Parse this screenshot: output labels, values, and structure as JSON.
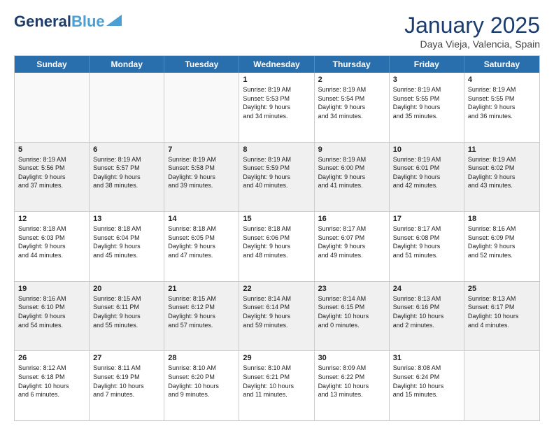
{
  "header": {
    "logo_general": "General",
    "logo_blue": "Blue",
    "month_title": "January 2025",
    "location": "Daya Vieja, Valencia, Spain"
  },
  "days_of_week": [
    "Sunday",
    "Monday",
    "Tuesday",
    "Wednesday",
    "Thursday",
    "Friday",
    "Saturday"
  ],
  "weeks": [
    [
      {
        "day": "",
        "text": ""
      },
      {
        "day": "",
        "text": ""
      },
      {
        "day": "",
        "text": ""
      },
      {
        "day": "1",
        "text": "Sunrise: 8:19 AM\nSunset: 5:53 PM\nDaylight: 9 hours\nand 34 minutes."
      },
      {
        "day": "2",
        "text": "Sunrise: 8:19 AM\nSunset: 5:54 PM\nDaylight: 9 hours\nand 34 minutes."
      },
      {
        "day": "3",
        "text": "Sunrise: 8:19 AM\nSunset: 5:55 PM\nDaylight: 9 hours\nand 35 minutes."
      },
      {
        "day": "4",
        "text": "Sunrise: 8:19 AM\nSunset: 5:55 PM\nDaylight: 9 hours\nand 36 minutes."
      }
    ],
    [
      {
        "day": "5",
        "text": "Sunrise: 8:19 AM\nSunset: 5:56 PM\nDaylight: 9 hours\nand 37 minutes."
      },
      {
        "day": "6",
        "text": "Sunrise: 8:19 AM\nSunset: 5:57 PM\nDaylight: 9 hours\nand 38 minutes."
      },
      {
        "day": "7",
        "text": "Sunrise: 8:19 AM\nSunset: 5:58 PM\nDaylight: 9 hours\nand 39 minutes."
      },
      {
        "day": "8",
        "text": "Sunrise: 8:19 AM\nSunset: 5:59 PM\nDaylight: 9 hours\nand 40 minutes."
      },
      {
        "day": "9",
        "text": "Sunrise: 8:19 AM\nSunset: 6:00 PM\nDaylight: 9 hours\nand 41 minutes."
      },
      {
        "day": "10",
        "text": "Sunrise: 8:19 AM\nSunset: 6:01 PM\nDaylight: 9 hours\nand 42 minutes."
      },
      {
        "day": "11",
        "text": "Sunrise: 8:19 AM\nSunset: 6:02 PM\nDaylight: 9 hours\nand 43 minutes."
      }
    ],
    [
      {
        "day": "12",
        "text": "Sunrise: 8:18 AM\nSunset: 6:03 PM\nDaylight: 9 hours\nand 44 minutes."
      },
      {
        "day": "13",
        "text": "Sunrise: 8:18 AM\nSunset: 6:04 PM\nDaylight: 9 hours\nand 45 minutes."
      },
      {
        "day": "14",
        "text": "Sunrise: 8:18 AM\nSunset: 6:05 PM\nDaylight: 9 hours\nand 47 minutes."
      },
      {
        "day": "15",
        "text": "Sunrise: 8:18 AM\nSunset: 6:06 PM\nDaylight: 9 hours\nand 48 minutes."
      },
      {
        "day": "16",
        "text": "Sunrise: 8:17 AM\nSunset: 6:07 PM\nDaylight: 9 hours\nand 49 minutes."
      },
      {
        "day": "17",
        "text": "Sunrise: 8:17 AM\nSunset: 6:08 PM\nDaylight: 9 hours\nand 51 minutes."
      },
      {
        "day": "18",
        "text": "Sunrise: 8:16 AM\nSunset: 6:09 PM\nDaylight: 9 hours\nand 52 minutes."
      }
    ],
    [
      {
        "day": "19",
        "text": "Sunrise: 8:16 AM\nSunset: 6:10 PM\nDaylight: 9 hours\nand 54 minutes."
      },
      {
        "day": "20",
        "text": "Sunrise: 8:15 AM\nSunset: 6:11 PM\nDaylight: 9 hours\nand 55 minutes."
      },
      {
        "day": "21",
        "text": "Sunrise: 8:15 AM\nSunset: 6:12 PM\nDaylight: 9 hours\nand 57 minutes."
      },
      {
        "day": "22",
        "text": "Sunrise: 8:14 AM\nSunset: 6:14 PM\nDaylight: 9 hours\nand 59 minutes."
      },
      {
        "day": "23",
        "text": "Sunrise: 8:14 AM\nSunset: 6:15 PM\nDaylight: 10 hours\nand 0 minutes."
      },
      {
        "day": "24",
        "text": "Sunrise: 8:13 AM\nSunset: 6:16 PM\nDaylight: 10 hours\nand 2 minutes."
      },
      {
        "day": "25",
        "text": "Sunrise: 8:13 AM\nSunset: 6:17 PM\nDaylight: 10 hours\nand 4 minutes."
      }
    ],
    [
      {
        "day": "26",
        "text": "Sunrise: 8:12 AM\nSunset: 6:18 PM\nDaylight: 10 hours\nand 6 minutes."
      },
      {
        "day": "27",
        "text": "Sunrise: 8:11 AM\nSunset: 6:19 PM\nDaylight: 10 hours\nand 7 minutes."
      },
      {
        "day": "28",
        "text": "Sunrise: 8:10 AM\nSunset: 6:20 PM\nDaylight: 10 hours\nand 9 minutes."
      },
      {
        "day": "29",
        "text": "Sunrise: 8:10 AM\nSunset: 6:21 PM\nDaylight: 10 hours\nand 11 minutes."
      },
      {
        "day": "30",
        "text": "Sunrise: 8:09 AM\nSunset: 6:22 PM\nDaylight: 10 hours\nand 13 minutes."
      },
      {
        "day": "31",
        "text": "Sunrise: 8:08 AM\nSunset: 6:24 PM\nDaylight: 10 hours\nand 15 minutes."
      },
      {
        "day": "",
        "text": ""
      }
    ]
  ]
}
